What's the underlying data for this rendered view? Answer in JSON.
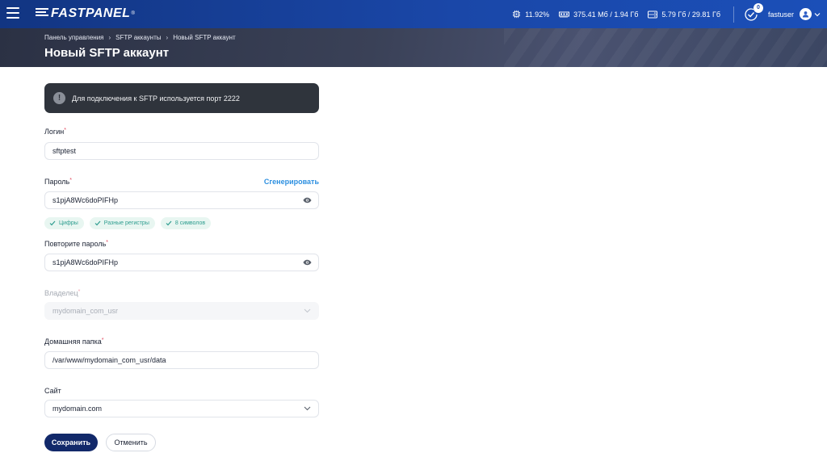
{
  "topbar": {
    "logo_text": "FASTPANEL",
    "logo_reg": "®",
    "cpu": "11.92%",
    "memory": "375.41 Мб / 1.94 Гб",
    "disk": "5.79 Гб / 29.81 Гб",
    "notifications_count": "0",
    "username": "fastuser"
  },
  "header": {
    "breadcrumb": [
      "Панель управления",
      "SFTP аккаунты",
      "Новый SFTP аккаунт"
    ],
    "title": "Новый SFTP аккаунт"
  },
  "info": {
    "icon": "!",
    "text": "Для подключения к SFTP используется порт 2222"
  },
  "form": {
    "login": {
      "label": "Логин",
      "value": "sftptest"
    },
    "password": {
      "label": "Пароль",
      "generate_label": "Сгенерировать",
      "value": "s1pjA8Wc6doPIFHp",
      "checks": [
        "Цифры",
        "Разные регистры",
        "8 символов"
      ]
    },
    "password_repeat": {
      "label": "Повторите пароль",
      "value": "s1pjA8Wc6doPIFHp"
    },
    "owner": {
      "label": "Владелец",
      "value": "mydomain_com_usr"
    },
    "home_dir": {
      "label": "Домашняя папка",
      "value": "/var/www/mydomain_com_usr/data"
    },
    "site": {
      "label": "Сайт",
      "value": "mydomain.com"
    },
    "required_mark": "*"
  },
  "actions": {
    "save": "Сохранить",
    "cancel": "Отменить"
  },
  "colors": {
    "topbar": "#1a47a8",
    "primary_button": "#12296a",
    "link": "#2c8fe0",
    "required": "#e0465b",
    "chip_text": "#2e9d8f"
  }
}
